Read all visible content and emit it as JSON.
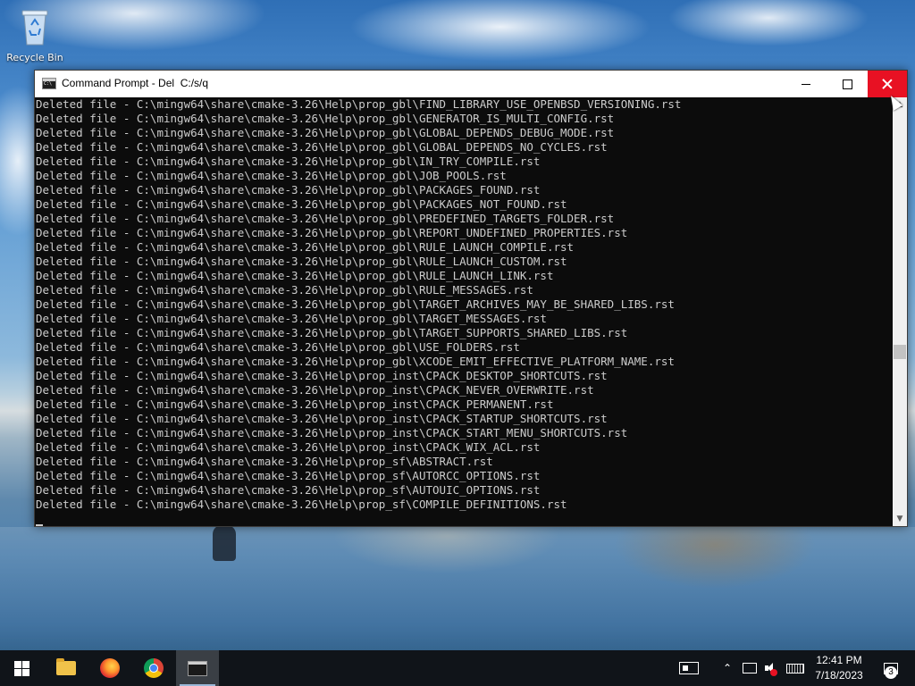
{
  "desktop": {
    "icons": [
      {
        "label": "Recycle Bin",
        "icon": "recycle-bin-icon"
      }
    ]
  },
  "window": {
    "title": "Command Prompt - Del  C:/s/q",
    "icon": "cmd-icon",
    "controls": {
      "minimize": "minimize-icon",
      "maximize": "maximize-icon",
      "close": "close-icon"
    },
    "close_hover_color": "#e81123",
    "console_bg": "#0c0c0c",
    "console_fg": "#cccccc",
    "lines": [
      "Deleted file - C:\\mingw64\\share\\cmake-3.26\\Help\\prop_gbl\\FIND_LIBRARY_USE_OPENBSD_VERSIONING.rst",
      "Deleted file - C:\\mingw64\\share\\cmake-3.26\\Help\\prop_gbl\\GENERATOR_IS_MULTI_CONFIG.rst",
      "Deleted file - C:\\mingw64\\share\\cmake-3.26\\Help\\prop_gbl\\GLOBAL_DEPENDS_DEBUG_MODE.rst",
      "Deleted file - C:\\mingw64\\share\\cmake-3.26\\Help\\prop_gbl\\GLOBAL_DEPENDS_NO_CYCLES.rst",
      "Deleted file - C:\\mingw64\\share\\cmake-3.26\\Help\\prop_gbl\\IN_TRY_COMPILE.rst",
      "Deleted file - C:\\mingw64\\share\\cmake-3.26\\Help\\prop_gbl\\JOB_POOLS.rst",
      "Deleted file - C:\\mingw64\\share\\cmake-3.26\\Help\\prop_gbl\\PACKAGES_FOUND.rst",
      "Deleted file - C:\\mingw64\\share\\cmake-3.26\\Help\\prop_gbl\\PACKAGES_NOT_FOUND.rst",
      "Deleted file - C:\\mingw64\\share\\cmake-3.26\\Help\\prop_gbl\\PREDEFINED_TARGETS_FOLDER.rst",
      "Deleted file - C:\\mingw64\\share\\cmake-3.26\\Help\\prop_gbl\\REPORT_UNDEFINED_PROPERTIES.rst",
      "Deleted file - C:\\mingw64\\share\\cmake-3.26\\Help\\prop_gbl\\RULE_LAUNCH_COMPILE.rst",
      "Deleted file - C:\\mingw64\\share\\cmake-3.26\\Help\\prop_gbl\\RULE_LAUNCH_CUSTOM.rst",
      "Deleted file - C:\\mingw64\\share\\cmake-3.26\\Help\\prop_gbl\\RULE_LAUNCH_LINK.rst",
      "Deleted file - C:\\mingw64\\share\\cmake-3.26\\Help\\prop_gbl\\RULE_MESSAGES.rst",
      "Deleted file - C:\\mingw64\\share\\cmake-3.26\\Help\\prop_gbl\\TARGET_ARCHIVES_MAY_BE_SHARED_LIBS.rst",
      "Deleted file - C:\\mingw64\\share\\cmake-3.26\\Help\\prop_gbl\\TARGET_MESSAGES.rst",
      "Deleted file - C:\\mingw64\\share\\cmake-3.26\\Help\\prop_gbl\\TARGET_SUPPORTS_SHARED_LIBS.rst",
      "Deleted file - C:\\mingw64\\share\\cmake-3.26\\Help\\prop_gbl\\USE_FOLDERS.rst",
      "Deleted file - C:\\mingw64\\share\\cmake-3.26\\Help\\prop_gbl\\XCODE_EMIT_EFFECTIVE_PLATFORM_NAME.rst",
      "Deleted file - C:\\mingw64\\share\\cmake-3.26\\Help\\prop_inst\\CPACK_DESKTOP_SHORTCUTS.rst",
      "Deleted file - C:\\mingw64\\share\\cmake-3.26\\Help\\prop_inst\\CPACK_NEVER_OVERWRITE.rst",
      "Deleted file - C:\\mingw64\\share\\cmake-3.26\\Help\\prop_inst\\CPACK_PERMANENT.rst",
      "Deleted file - C:\\mingw64\\share\\cmake-3.26\\Help\\prop_inst\\CPACK_STARTUP_SHORTCUTS.rst",
      "Deleted file - C:\\mingw64\\share\\cmake-3.26\\Help\\prop_inst\\CPACK_START_MENU_SHORTCUTS.rst",
      "Deleted file - C:\\mingw64\\share\\cmake-3.26\\Help\\prop_inst\\CPACK_WIX_ACL.rst",
      "Deleted file - C:\\mingw64\\share\\cmake-3.26\\Help\\prop_sf\\ABSTRACT.rst",
      "Deleted file - C:\\mingw64\\share\\cmake-3.26\\Help\\prop_sf\\AUTORCC_OPTIONS.rst",
      "Deleted file - C:\\mingw64\\share\\cmake-3.26\\Help\\prop_sf\\AUTOUIC_OPTIONS.rst",
      "Deleted file - C:\\mingw64\\share\\cmake-3.26\\Help\\prop_sf\\COMPILE_DEFINITIONS.rst"
    ]
  },
  "taskbar": {
    "pinned": [
      {
        "name": "start-button",
        "icon": "windows-logo-icon"
      },
      {
        "name": "file-explorer",
        "icon": "folder-icon"
      },
      {
        "name": "firefox",
        "icon": "firefox-icon"
      },
      {
        "name": "chrome",
        "icon": "chrome-icon"
      },
      {
        "name": "command-prompt",
        "icon": "cmd-icon",
        "active": true
      }
    ],
    "tray_icons": [
      "news-icon",
      "chevron-up-icon",
      "network-icon",
      "volume-muted-icon",
      "keyboard-icon"
    ],
    "clock": {
      "time": "12:41 PM",
      "date": "7/18/2023"
    },
    "notifications": {
      "icon": "notification-icon",
      "count": "3"
    }
  }
}
